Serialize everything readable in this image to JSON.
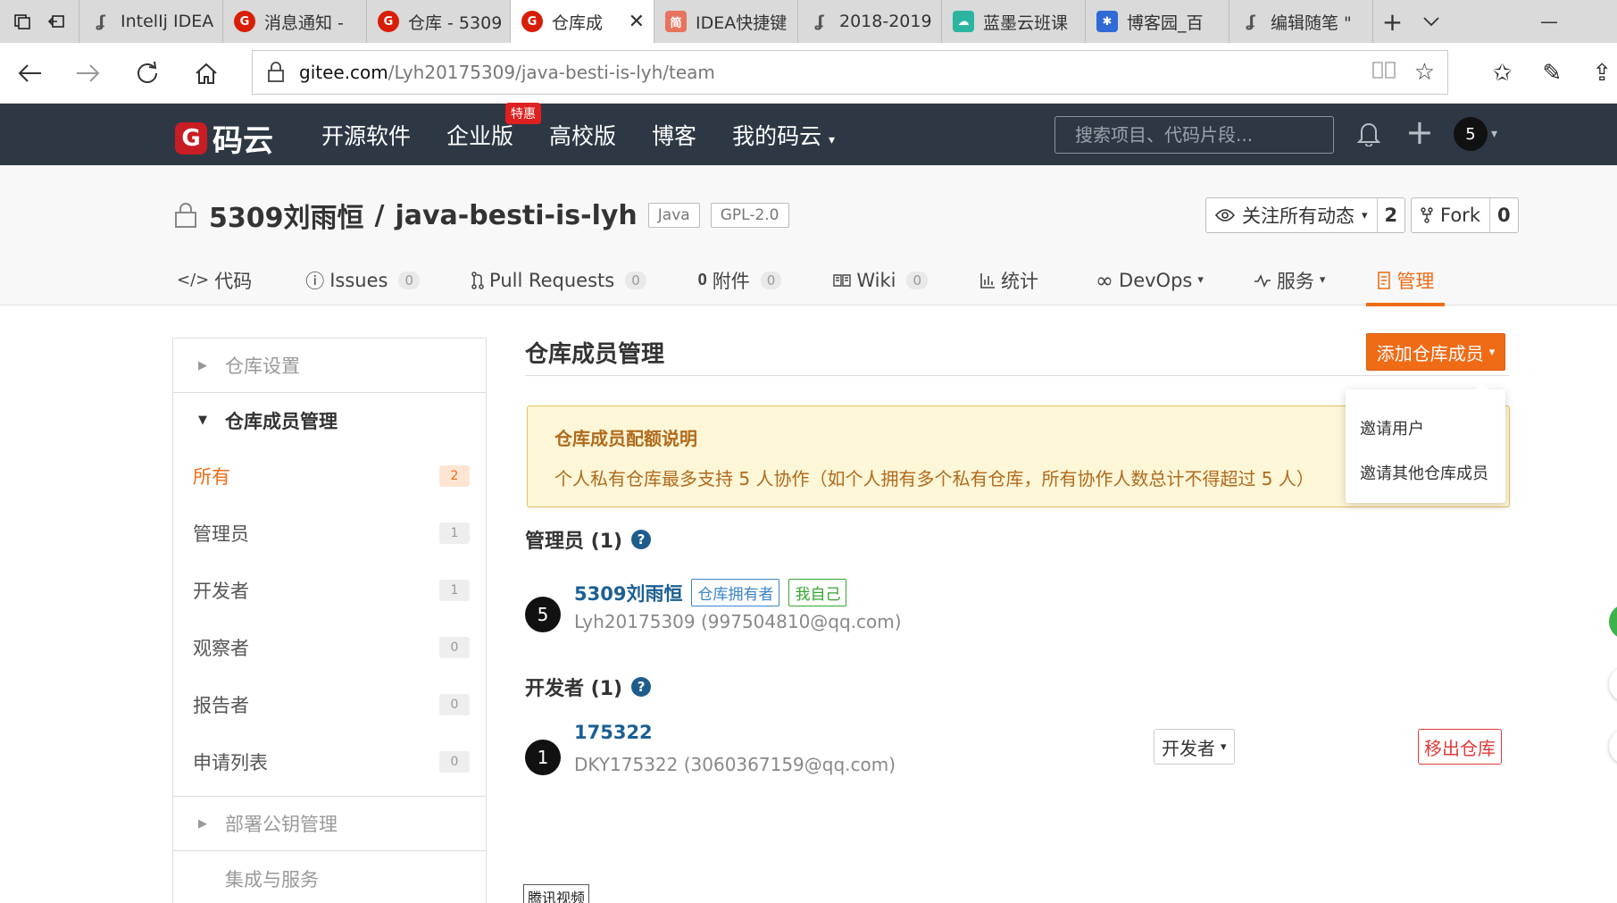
{
  "browser": {
    "tabs": [
      {
        "title": "IntelIj IDEA",
        "icon": "script-icon"
      },
      {
        "title": "消息通知 -",
        "icon": "gitee-icon"
      },
      {
        "title": "仓库 - 5309",
        "icon": "gitee-icon"
      },
      {
        "title": "仓库成",
        "icon": "gitee-icon",
        "active": true
      },
      {
        "title": "IDEA快捷键",
        "icon": "jianshu-icon"
      },
      {
        "title": "2018-2019-",
        "icon": "script-icon"
      },
      {
        "title": "蓝墨云班课",
        "icon": "cloud-icon"
      },
      {
        "title": "博客园_百",
        "icon": "paw-icon"
      },
      {
        "title": "编辑随笔 \"",
        "icon": "script-icon"
      }
    ],
    "jian_glyph": "简",
    "address_host": "gitee.com",
    "address_path": "/Lyh20175309/java-besti-is-lyh/team"
  },
  "header": {
    "logo_text": "码云",
    "nav": [
      "开源软件",
      "企业版",
      "高校版",
      "博客",
      "我的码云"
    ],
    "hot_badge": "特惠",
    "search_placeholder": "搜索项目、代码片段...",
    "avatar_letter": "5"
  },
  "repo": {
    "owner": "5309刘雨恒",
    "separator": "/",
    "name": "java-besti-is-lyh",
    "lang_tag": "Java",
    "license_tag": "GPL-2.0",
    "watch_label": "关注所有动态",
    "watch_count": "2",
    "fork_label": "Fork",
    "fork_count": "0",
    "tabs": [
      {
        "label": "代码",
        "icon": "code-icon"
      },
      {
        "label": "Issues",
        "icon": "issue-icon",
        "count": "0"
      },
      {
        "label": "Pull Requests",
        "icon": "pull-request-icon",
        "count": "0"
      },
      {
        "label": "附件",
        "icon": "paperclip-icon",
        "count": "0"
      },
      {
        "label": "Wiki",
        "icon": "book-icon",
        "count": "0"
      },
      {
        "label": "统计",
        "icon": "bar-chart-icon"
      },
      {
        "label": "DevOps",
        "icon": "infinity-icon"
      },
      {
        "label": "服务",
        "icon": "pulse-icon"
      },
      {
        "label": "管理",
        "icon": "manage-icon",
        "active": true
      }
    ]
  },
  "sidebar": {
    "sections": {
      "repo_settings": "仓库设置",
      "member_management": "仓库成员管理",
      "deploy_keys": "部署公钥管理",
      "integrations": "集成与服务"
    },
    "items": [
      {
        "label": "所有",
        "count": "2",
        "active": true
      },
      {
        "label": "管理员",
        "count": "1"
      },
      {
        "label": "开发者",
        "count": "1"
      },
      {
        "label": "观察者",
        "count": "0"
      },
      {
        "label": "报告者",
        "count": "0"
      },
      {
        "label": "申请列表",
        "count": "0"
      }
    ]
  },
  "main": {
    "title": "仓库成员管理",
    "add_button": "添加仓库成员",
    "dropdown": [
      "邀请用户",
      "邀请其他仓库成员"
    ],
    "notice_title": "仓库成员配额说明",
    "notice_body": "个人私有仓库最多支持 5 人协作（如个人拥有多个私有仓库，所有协作人数总计不得超过 5 人）",
    "admin_group": "管理员 (1)",
    "dev_group": "开发者 (1)",
    "help_glyph": "?",
    "admin_member": {
      "avatar": "5",
      "name": "5309刘雨恒",
      "tag_owner": "仓库拥有者",
      "tag_self": "我自己",
      "sub": "Lyh20175309 (997504810@qq.com)"
    },
    "dev_member": {
      "avatar": "1",
      "name": "175322",
      "sub": "DKY175322 (3060367159@qq.com)",
      "role": "开发者",
      "remove": "移出仓库"
    },
    "tencent_label": "腾讯视频"
  },
  "colors": {
    "accent": "#f06b16",
    "header_bg": "#2e3844",
    "link": "#1b5f93"
  }
}
